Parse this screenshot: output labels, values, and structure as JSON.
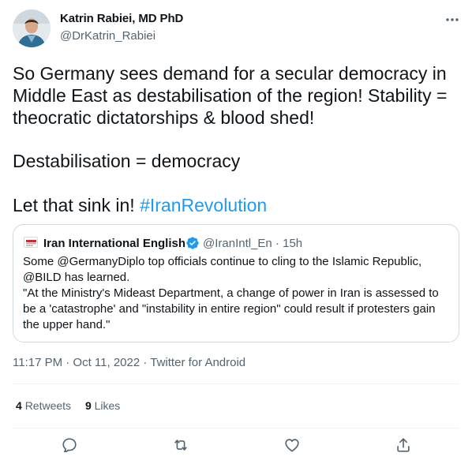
{
  "tweet": {
    "author": {
      "name": "Katrin Rabiei, MD PhD",
      "handle": "@DrKatrin_Rabiei"
    },
    "text_lines": [
      "So Germany sees demand for a secular democracy in",
      "Middle East as destabilisation of the region! Stability =",
      "theocratic dictatorships & blood shed!",
      "Destabilisation = democracy",
      "Let that sink in! "
    ],
    "hashtag": "#IranRevolution",
    "quoted": {
      "name": "Iran International English",
      "handle_time": "@IranIntl_En · 15h",
      "text_lines": [
        "Some @GermanyDiplo top officials continue to cling to the Islamic Republic,",
        "@BILD has learned.",
        "\"At the Ministry's Mideast Department, a change of power in Iran is assessed to",
        "be a 'catastrophe' and \"instability in entire region\" could result if protesters gain",
        "the upper hand.\""
      ]
    },
    "timestamp": "11:17 PM · Oct 11, 2022 · ",
    "source": "Twitter for Android",
    "stats": {
      "retweets_count": "4",
      "retweets_label": "Retweets",
      "likes_count": "9",
      "likes_label": "Likes"
    }
  },
  "icons": [
    "more-icon",
    "verified-icon",
    "reply-icon",
    "retweet-icon",
    "like-icon",
    "share-icon"
  ],
  "colors": {
    "text": "#0f1419",
    "secondary": "#536471",
    "accent": "#1d9bf0",
    "border": "#cfd9de"
  }
}
